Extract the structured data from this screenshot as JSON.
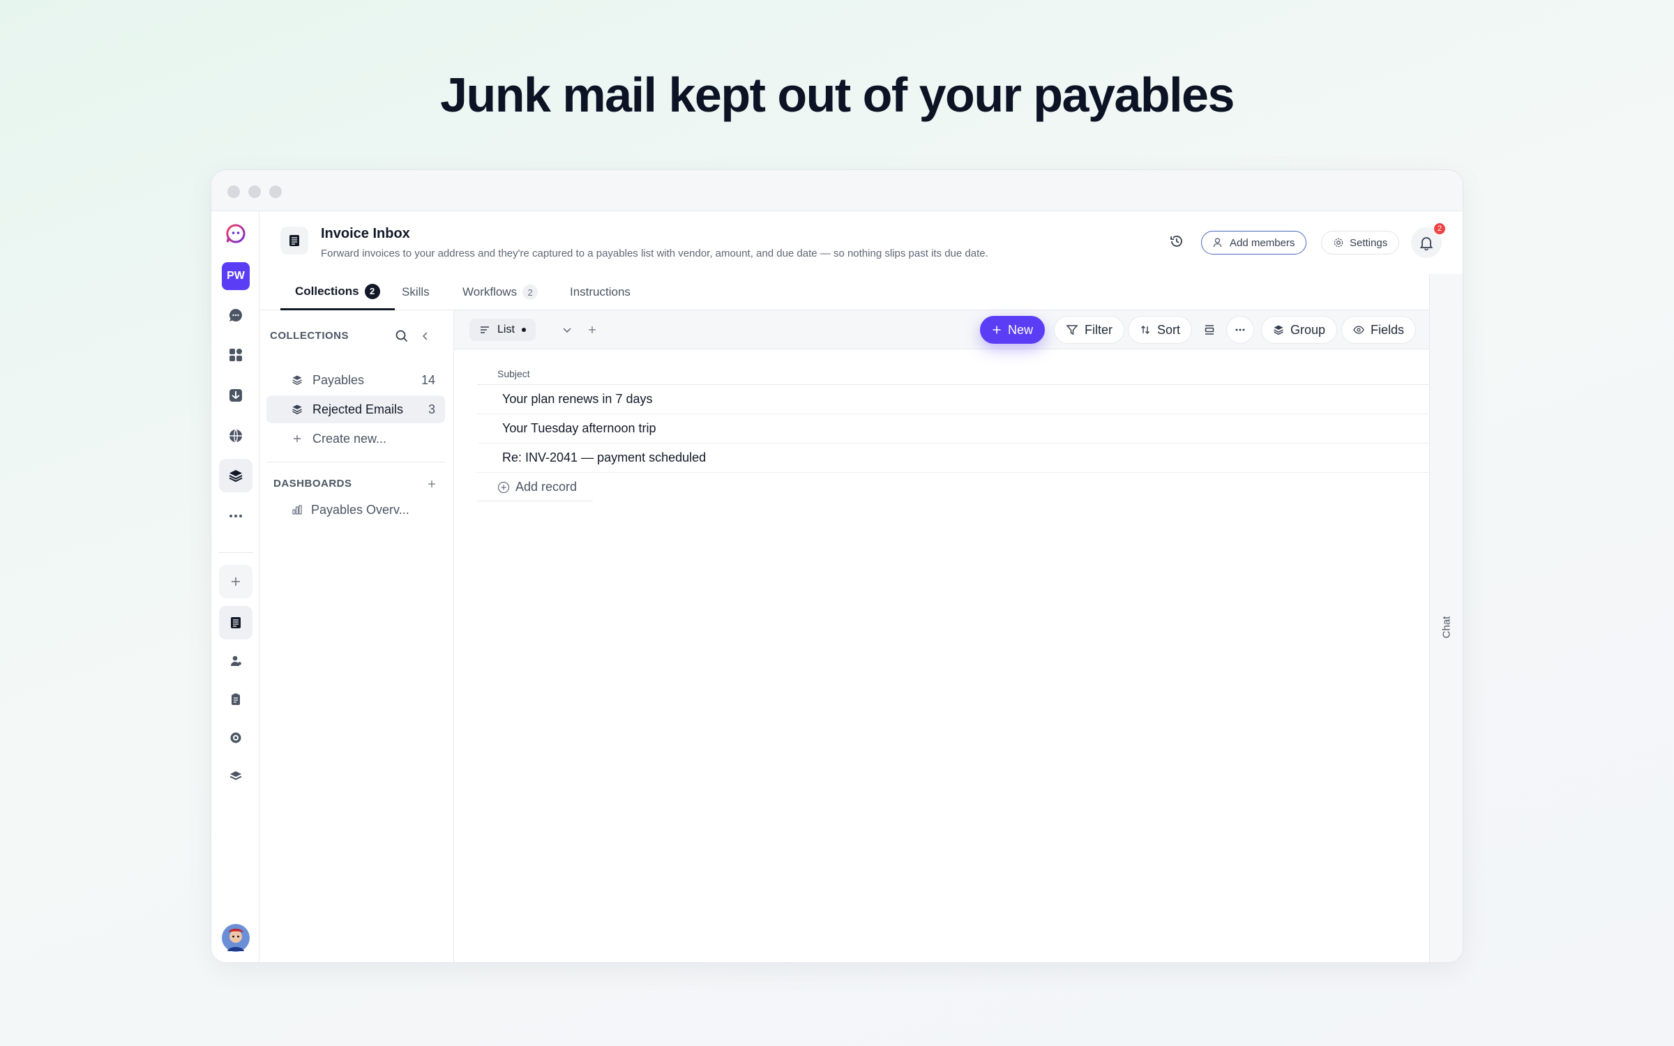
{
  "hero": {
    "title": "Junk mail kept out of your payables"
  },
  "rail": {
    "workspace_initials": "PW"
  },
  "header": {
    "title": "Invoice Inbox",
    "subtitle": "Forward invoices to your address and they're captured to a payables list with vendor, amount, and due date — so nothing slips past its due date.",
    "add_members_label": "Add members",
    "settings_label": "Settings",
    "notification_count": "2"
  },
  "tabs": [
    {
      "label": "Collections",
      "count": "2"
    },
    {
      "label": "Skills"
    },
    {
      "label": "Workflows",
      "count": "2"
    },
    {
      "label": "Instructions"
    }
  ],
  "sidebar": {
    "collections_heading": "COLLECTIONS",
    "collections": [
      {
        "label": "Payables",
        "count": "14"
      },
      {
        "label": "Rejected Emails",
        "count": "3"
      }
    ],
    "create_new_label": "Create new...",
    "dashboards_heading": "DASHBOARDS",
    "dashboards": [
      {
        "label": "Payables Overv..."
      }
    ]
  },
  "toolbar": {
    "view_label": "List",
    "new_label": "New",
    "filter_label": "Filter",
    "sort_label": "Sort",
    "group_label": "Group",
    "fields_label": "Fields"
  },
  "table": {
    "column_header": "Subject",
    "rows": [
      "Your plan renews in 7 days",
      "Your Tuesday afternoon trip",
      "Re: INV-2041 — payment scheduled"
    ],
    "add_record_label": "Add record"
  },
  "chat": {
    "label": "Chat"
  },
  "colors": {
    "accent": "#5b3df5",
    "badge": "#ef4444",
    "text": "#111827"
  }
}
